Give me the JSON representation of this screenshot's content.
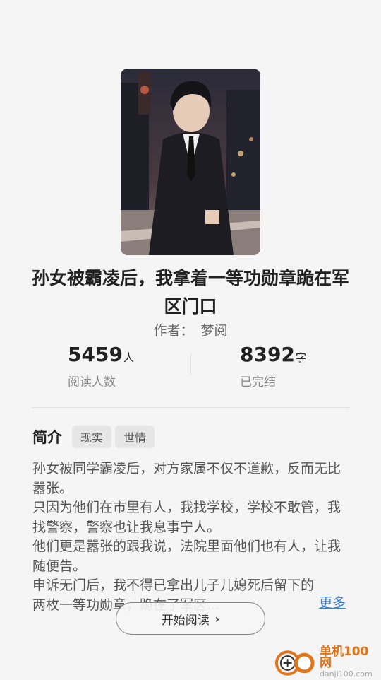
{
  "book": {
    "title": "孙女被霸凌后，我拿着一等功勋章跪在军区门口",
    "author_label": "作者：",
    "author": "梦阅"
  },
  "stats": {
    "readers": {
      "value": "5459",
      "unit": "人",
      "label": "阅读人数"
    },
    "words": {
      "value": "8392",
      "unit": "字",
      "label": "已完结"
    }
  },
  "intro": {
    "heading": "简介",
    "tags": [
      "现实",
      "世情"
    ],
    "paragraphs": [
      "孙女被同学霸凌后，对方家属不仅不道歉，反而无比嚣张。",
      "只因为他们在市里有人，我找学校，学校不敢管，我找警察，警察也让我息事宁人。",
      "他们更是嚣张的跟我说，法院里面他们也有人，让我随便告。"
    ],
    "last_paragraph_line1": "申诉无门后，我不得已拿出儿子儿媳死后留下的",
    "last_paragraph_line2": "两枚一等功勋章，跪在了军区...",
    "more_label": "更多"
  },
  "actions": {
    "start_reading_label": "开始阅读"
  },
  "watermark": {
    "name": "单机100网",
    "url": "danji100.com"
  },
  "colors": {
    "accent_link": "#3a7bd5",
    "watermark_orange": "#e2741b"
  }
}
